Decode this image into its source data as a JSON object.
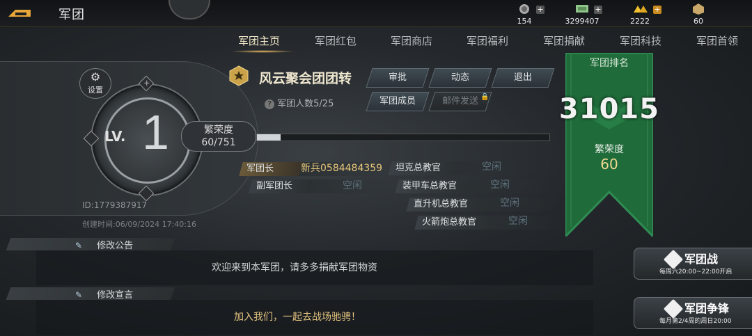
{
  "header": {
    "title": "军团",
    "resources": [
      {
        "icon": "medal-icon",
        "value": "154"
      },
      {
        "icon": "cash-icon",
        "value": "3299407"
      },
      {
        "icon": "gold-icon",
        "value": "2222"
      },
      {
        "icon": "supply-icon",
        "value": "60"
      }
    ]
  },
  "tabs": [
    "军团主页",
    "军团红包",
    "军团商店",
    "军团福利",
    "军团捐献",
    "军团科技",
    "军团首领"
  ],
  "level": {
    "label": "LV.",
    "value": "1"
  },
  "settings_label": "设置",
  "prosperity": {
    "label": "繁荣度",
    "value": "60/751",
    "fraction": 0.08
  },
  "legion": {
    "name": "风云聚会团团转",
    "members": "军团人数5/25",
    "id": "ID:1779387917",
    "created": "创建时间:06/09/2024 17:40:16"
  },
  "actions": {
    "approve": "审批",
    "activity": "动态",
    "quit": "退出",
    "members": "军团成员",
    "mail": "邮件发送"
  },
  "officers": {
    "leader": {
      "role": "军团长",
      "name": "新兵0584484359"
    },
    "deputy": {
      "role": "副军团长",
      "name": "空闲"
    },
    "tank": {
      "role": "坦克总教官",
      "name": "空闲"
    },
    "armor": {
      "role": "装甲车总教官",
      "name": "空闲"
    },
    "heli": {
      "role": "直升机总教官",
      "name": "空闲"
    },
    "rocket": {
      "role": "火箭炮总教官",
      "name": "空闲"
    }
  },
  "ranking": {
    "title": "军团排名",
    "value": "31015",
    "pros_label": "繁荣度",
    "pros_value": "60"
  },
  "announcement": {
    "edit_label": "修改公告",
    "text": "欢迎来到本军团，请多多捐献军团物资"
  },
  "declaration": {
    "edit_label": "修改宣言",
    "text": "加入我们，一起去战场驰骋！"
  },
  "war": {
    "battle": {
      "title": "军团战",
      "schedule": "每周六20:00~22:00开启"
    },
    "contest": {
      "title": "军团争锋",
      "schedule": "每月第2/4周的周日20:00"
    }
  },
  "colors": {
    "accent_gold": "#e8c77a",
    "banner_green": "#1f6b3a",
    "empty_slot": "#5d7079"
  }
}
